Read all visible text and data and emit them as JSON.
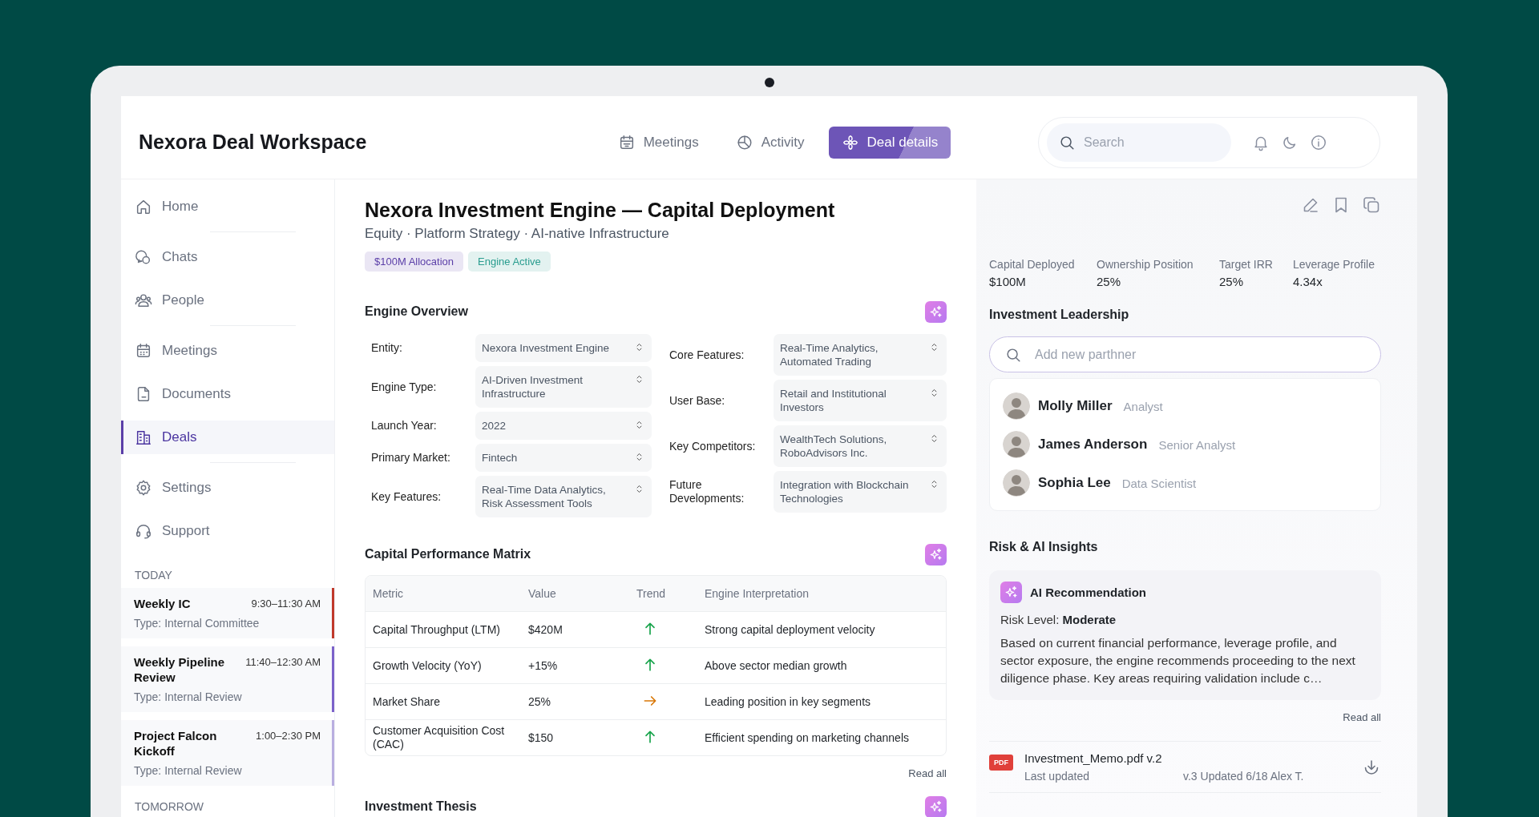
{
  "header": {
    "title": "Nexora Deal Workspace",
    "tabs": [
      {
        "label": "Meetings",
        "selected": false
      },
      {
        "label": "Activity",
        "selected": false
      },
      {
        "label": "Deal details",
        "selected": true
      }
    ],
    "search": {
      "placeholder": "Search"
    }
  },
  "sidebar": {
    "nav_groups": [
      [
        {
          "label": "Home",
          "selected": false
        }
      ],
      [
        {
          "label": "Chats",
          "selected": false
        },
        {
          "label": "People",
          "selected": false
        }
      ],
      [
        {
          "label": "Meetings",
          "selected": false
        },
        {
          "label": "Documents",
          "selected": false
        },
        {
          "label": "Deals",
          "selected": true
        }
      ],
      [
        {
          "label": "Settings",
          "selected": false
        },
        {
          "label": "Support",
          "selected": false
        }
      ]
    ],
    "agenda": [
      {
        "heading": "TODAY",
        "meetings": [
          {
            "title": "Weekly IC",
            "time": "9:30–11:30 AM",
            "type": "Type: Internal Committee",
            "color": "#c0392b"
          },
          {
            "title": "Weekly Pipeline Review",
            "time": "11:40–12:30 AM",
            "type": "Type: Internal Review",
            "color": "#7b61c9"
          },
          {
            "title": "Project Falcon Kickoff",
            "time": "1:00–2:30 PM",
            "type": "Type: Internal Review",
            "color": "#b9aee0"
          }
        ]
      },
      {
        "heading": "TOMORROW"
      }
    ]
  },
  "main": {
    "title": "Nexora Investment Engine — Capital Deployment",
    "subtitle": "Equity · Platform Strategy · AI-native Infrastructure",
    "badges": [
      {
        "label": "$100M Allocation",
        "color": "#5b3fa8"
      },
      {
        "label": "Engine Active",
        "color": "#2a9d8f"
      }
    ],
    "engine_overview": {
      "title": "Engine Overview",
      "columns": [
        [
          {
            "label": "Entity:",
            "value": "Nexora Investment Engine"
          },
          {
            "label": "Engine Type:",
            "value": "AI-Driven Investment Infrastructure"
          },
          {
            "label": "Launch Year:",
            "value": "2022"
          },
          {
            "label": "Primary Market:",
            "value": "Fintech"
          },
          {
            "label": "Key Features:",
            "value": "Real-Time Data Analytics, Risk Assessment Tools"
          }
        ],
        [
          {
            "label": "Core Features:",
            "value": "Real-Time Analytics, Automated Trading"
          },
          {
            "label": "User Base:",
            "value": "Retail and Institutional Investors"
          },
          {
            "label": "Key Competitors:",
            "value": "WealthTech Solutions, RoboAdvisors Inc."
          },
          {
            "label": "Future Developments:",
            "value": "Integration with Blockchain Technologies"
          }
        ]
      ]
    },
    "performance": {
      "title": "Capital Performance Matrix",
      "columns": [
        "Metric",
        "Value",
        "Trend",
        "Engine Interpretation"
      ],
      "rows": [
        {
          "metric": "Capital Throughput (LTM)",
          "value": "$420M",
          "trend_up": true,
          "interpretation": "Strong capital deployment velocity"
        },
        {
          "metric": "Growth Velocity (YoY)",
          "value": "+15%",
          "trend_up": true,
          "interpretation": "Above sector median growth"
        },
        {
          "metric": "Market Share",
          "value": "25%",
          "trend_up": false,
          "interpretation": "Leading position in key segments"
        },
        {
          "metric": "Customer Acquisition Cost (CAC)",
          "value": "$150",
          "trend_up": true,
          "interpretation": "Efficient spending on marketing channels"
        }
      ],
      "read_all": "Read all"
    },
    "thesis": {
      "title": "Investment Thesis"
    }
  },
  "details": {
    "stats": [
      {
        "label": "Capital Deployed",
        "value": "$100M"
      },
      {
        "label": "Ownership Position",
        "value": "25%"
      },
      {
        "label": "Target IRR",
        "value": "25%"
      },
      {
        "label": "Leverage Profile",
        "value": "4.34x"
      }
    ],
    "leadership": {
      "title": "Investment Leadership",
      "search_placeholder": "Add new parthner",
      "people": [
        {
          "name": "Molly Miller",
          "role": "Analyst"
        },
        {
          "name": "James Anderson",
          "role": "Senior Analyst"
        },
        {
          "name": "Sophia Lee",
          "role": "Data Scientist"
        }
      ]
    },
    "insights": {
      "title": "Risk & AI Insights",
      "card_title": "AI Recommendation",
      "risk": "Risk Level: **Moderate**",
      "text": "Based on current financial performance, leverage profile, and sector exposure, the engine recommends proceeding to the next diligence phase. Key areas requiring validation include c…",
      "read_all": "Read all"
    },
    "file": {
      "badge": "PDF",
      "name": "Investment_Memo.pdf v.2",
      "updated_label": "Last updated",
      "updated_info": "v.3 Updated 6/18 Alex T."
    }
  }
}
